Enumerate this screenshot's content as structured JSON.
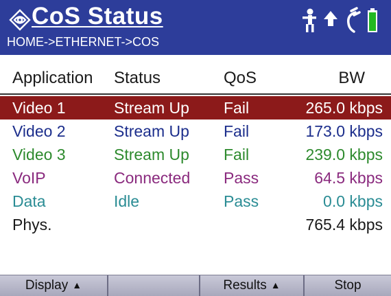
{
  "header": {
    "title": "CoS Status",
    "breadcrumb": "HOME->ETHERNET->COS",
    "background": "#2d3d9a",
    "icons": [
      "logo-icon",
      "person-icon",
      "arrow-up-icon",
      "plug-icon",
      "battery-icon"
    ]
  },
  "columns": {
    "application": "Application",
    "status": "Status",
    "qos": "QoS",
    "bw": "BW"
  },
  "rows": [
    {
      "application": "Video 1",
      "status": "Stream Up",
      "qos": "Fail",
      "bw": "265.0 kbps",
      "color": "#ffffff",
      "selected": true
    },
    {
      "application": "Video 2",
      "status": "Stream Up",
      "qos": "Fail",
      "bw": "173.0 kbps",
      "color": "#1c2e8c",
      "selected": false
    },
    {
      "application": "Video 3",
      "status": "Stream Up",
      "qos": "Fail",
      "bw": "239.0 kbps",
      "color": "#2d8a2d",
      "selected": false
    },
    {
      "application": "VoIP",
      "status": "Connected",
      "qos": "Pass",
      "bw": "64.5 kbps",
      "color": "#8a2a7e",
      "selected": false
    },
    {
      "application": "Data",
      "status": "Idle",
      "qos": "Pass",
      "bw": "0.0 kbps",
      "color": "#2a8c94",
      "selected": false
    },
    {
      "application": "Phys.",
      "status": "",
      "qos": "",
      "bw": "765.4 kbps",
      "color": "#1a1a1a",
      "selected": false
    }
  ],
  "selected_row_color": "#8c1a1a",
  "softkeys": {
    "display": "Display",
    "blank": "",
    "results": "Results",
    "stop": "Stop"
  }
}
